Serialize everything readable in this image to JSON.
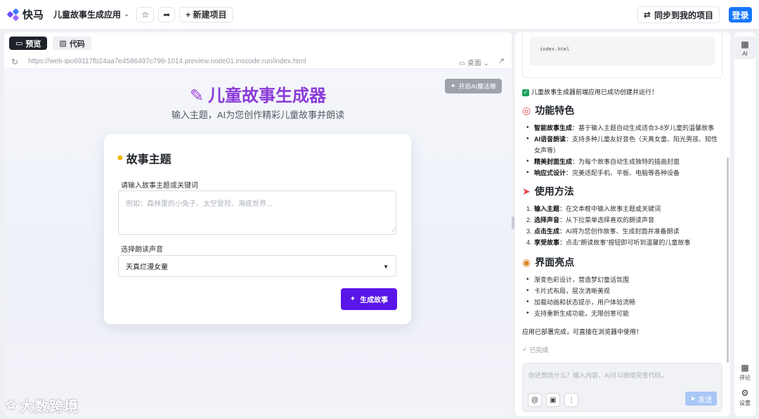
{
  "topbar": {
    "logo_text": "快马",
    "app_name": "儿童故事生成应用",
    "new_project": "新建项目",
    "sync_label": "同步到我的项目",
    "login_label": "登录"
  },
  "preview_tabs": [
    {
      "label": "预览",
      "active": true
    },
    {
      "label": "代码",
      "active": false
    }
  ],
  "urlbar": {
    "url": "https://web-ipo69117fb24aa7e4586497c799-1014.preview.node01.inscode.run/index.html",
    "device": "桌面"
  },
  "preview": {
    "magic_button": "开启AI魔法棒",
    "title": "儿童故事生成器",
    "subtitle": "输入主题，AI为您创作精彩儿童故事并朗读",
    "card": {
      "title": "故事主题",
      "topic_label": "请输入故事主题或关键词",
      "topic_placeholder": "例如：森林里的小兔子、太空冒险、海底世界...",
      "voice_label": "选择朗读声音",
      "voice_value": "天真烂漫女童",
      "generate_button": "生成故事"
    }
  },
  "watermark": "大数跨境",
  "chat": {
    "code_file": "index.html",
    "success_msg": "儿童故事生成器前端应用已成功创建并运行！",
    "features_title": "功能特色",
    "features": [
      {
        "bold": "智能故事生成",
        "text": "：基于输入主题自动生成适合3-8岁儿童的温馨故事"
      },
      {
        "bold": "AI语音朗读",
        "text": "：支持多种儿童友好音色（天真女童、阳光男孩、知性女声等）"
      },
      {
        "bold": "精美封面生成",
        "text": "：为每个故事自动生成独特的插画封面"
      },
      {
        "bold": "响应式设计",
        "text": "：完美适配手机、平板、电脑等各种设备"
      }
    ],
    "usage_title": "使用方法",
    "usage": [
      {
        "num": "1.",
        "bold": "输入主题",
        "text": "：在文本框中输入故事主题或关键词"
      },
      {
        "num": "2.",
        "bold": "选择声音",
        "text": "：从下拉菜单选择喜欢的朗读声音"
      },
      {
        "num": "3.",
        "bold": "点击生成",
        "text": "：AI将为您创作故事、生成封面并准备朗读"
      },
      {
        "num": "4.",
        "bold": "享受故事",
        "text": "：点击\"朗读故事\"按钮即可听到温馨的儿童故事"
      }
    ],
    "ui_title": "界面亮点",
    "ui_points": [
      "渐变色彩设计，营造梦幻童话氛围",
      "卡片式布局，层次清晰美观",
      "加载动画和状态提示，用户体验流畅",
      "支持重新生成功能，无限创意可能"
    ],
    "final_msg": "应用已部署完成，可直接在浏览器中使用！",
    "done_label": "已完成",
    "input_placeholder": "你还想改什么？输入内容，AI可以继续完善代码。",
    "send_label": "发送"
  },
  "rail": {
    "ai_label": "AI",
    "comment_label": "评论",
    "settings_label": "设置"
  },
  "colors": {
    "accent": "#1677ff",
    "generate_button": "#5a16e8",
    "title_purple": "#8a3ad8",
    "success_green": "#1ca35c"
  }
}
